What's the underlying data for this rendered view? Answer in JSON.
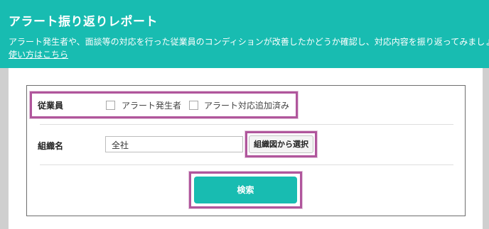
{
  "header": {
    "title": "アラート振り返りレポート",
    "description": "アラート発生者や、面談等の対応を行った従業員のコンディションが改善したかどうか確認し、対応内容を振り返ってみましょう。",
    "help_link": "使い方はこちら"
  },
  "filters": {
    "employee": {
      "label": "従業員",
      "options": [
        {
          "label": "アラート発生者",
          "checked": false
        },
        {
          "label": "アラート対応追加済み",
          "checked": false
        }
      ]
    },
    "organization": {
      "label": "組織名",
      "value": "全社",
      "select_button": "組織図から選択"
    },
    "search_button": "検索"
  },
  "colors": {
    "accent": "#18bcb1",
    "highlight": "#b0569c"
  }
}
